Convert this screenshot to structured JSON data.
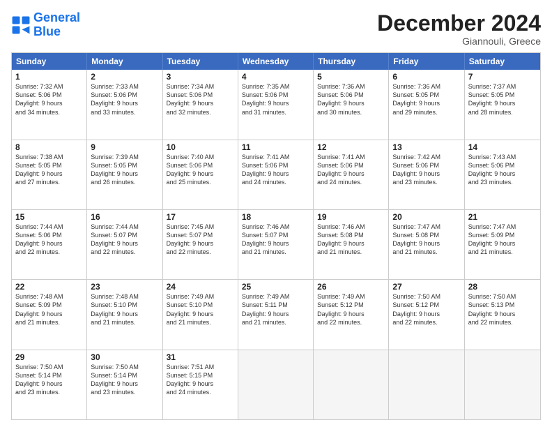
{
  "logo": {
    "general": "General",
    "blue": "Blue"
  },
  "header": {
    "month": "December 2024",
    "location": "Giannouli, Greece"
  },
  "weekdays": [
    "Sunday",
    "Monday",
    "Tuesday",
    "Wednesday",
    "Thursday",
    "Friday",
    "Saturday"
  ],
  "rows": [
    [
      {
        "day": "1",
        "lines": [
          "Sunrise: 7:32 AM",
          "Sunset: 5:06 PM",
          "Daylight: 9 hours",
          "and 34 minutes."
        ]
      },
      {
        "day": "2",
        "lines": [
          "Sunrise: 7:33 AM",
          "Sunset: 5:06 PM",
          "Daylight: 9 hours",
          "and 33 minutes."
        ]
      },
      {
        "day": "3",
        "lines": [
          "Sunrise: 7:34 AM",
          "Sunset: 5:06 PM",
          "Daylight: 9 hours",
          "and 32 minutes."
        ]
      },
      {
        "day": "4",
        "lines": [
          "Sunrise: 7:35 AM",
          "Sunset: 5:06 PM",
          "Daylight: 9 hours",
          "and 31 minutes."
        ]
      },
      {
        "day": "5",
        "lines": [
          "Sunrise: 7:36 AM",
          "Sunset: 5:06 PM",
          "Daylight: 9 hours",
          "and 30 minutes."
        ]
      },
      {
        "day": "6",
        "lines": [
          "Sunrise: 7:36 AM",
          "Sunset: 5:05 PM",
          "Daylight: 9 hours",
          "and 29 minutes."
        ]
      },
      {
        "day": "7",
        "lines": [
          "Sunrise: 7:37 AM",
          "Sunset: 5:05 PM",
          "Daylight: 9 hours",
          "and 28 minutes."
        ]
      }
    ],
    [
      {
        "day": "8",
        "lines": [
          "Sunrise: 7:38 AM",
          "Sunset: 5:05 PM",
          "Daylight: 9 hours",
          "and 27 minutes."
        ]
      },
      {
        "day": "9",
        "lines": [
          "Sunrise: 7:39 AM",
          "Sunset: 5:05 PM",
          "Daylight: 9 hours",
          "and 26 minutes."
        ]
      },
      {
        "day": "10",
        "lines": [
          "Sunrise: 7:40 AM",
          "Sunset: 5:06 PM",
          "Daylight: 9 hours",
          "and 25 minutes."
        ]
      },
      {
        "day": "11",
        "lines": [
          "Sunrise: 7:41 AM",
          "Sunset: 5:06 PM",
          "Daylight: 9 hours",
          "and 24 minutes."
        ]
      },
      {
        "day": "12",
        "lines": [
          "Sunrise: 7:41 AM",
          "Sunset: 5:06 PM",
          "Daylight: 9 hours",
          "and 24 minutes."
        ]
      },
      {
        "day": "13",
        "lines": [
          "Sunrise: 7:42 AM",
          "Sunset: 5:06 PM",
          "Daylight: 9 hours",
          "and 23 minutes."
        ]
      },
      {
        "day": "14",
        "lines": [
          "Sunrise: 7:43 AM",
          "Sunset: 5:06 PM",
          "Daylight: 9 hours",
          "and 23 minutes."
        ]
      }
    ],
    [
      {
        "day": "15",
        "lines": [
          "Sunrise: 7:44 AM",
          "Sunset: 5:06 PM",
          "Daylight: 9 hours",
          "and 22 minutes."
        ]
      },
      {
        "day": "16",
        "lines": [
          "Sunrise: 7:44 AM",
          "Sunset: 5:07 PM",
          "Daylight: 9 hours",
          "and 22 minutes."
        ]
      },
      {
        "day": "17",
        "lines": [
          "Sunrise: 7:45 AM",
          "Sunset: 5:07 PM",
          "Daylight: 9 hours",
          "and 22 minutes."
        ]
      },
      {
        "day": "18",
        "lines": [
          "Sunrise: 7:46 AM",
          "Sunset: 5:07 PM",
          "Daylight: 9 hours",
          "and 21 minutes."
        ]
      },
      {
        "day": "19",
        "lines": [
          "Sunrise: 7:46 AM",
          "Sunset: 5:08 PM",
          "Daylight: 9 hours",
          "and 21 minutes."
        ]
      },
      {
        "day": "20",
        "lines": [
          "Sunrise: 7:47 AM",
          "Sunset: 5:08 PM",
          "Daylight: 9 hours",
          "and 21 minutes."
        ]
      },
      {
        "day": "21",
        "lines": [
          "Sunrise: 7:47 AM",
          "Sunset: 5:09 PM",
          "Daylight: 9 hours",
          "and 21 minutes."
        ]
      }
    ],
    [
      {
        "day": "22",
        "lines": [
          "Sunrise: 7:48 AM",
          "Sunset: 5:09 PM",
          "Daylight: 9 hours",
          "and 21 minutes."
        ]
      },
      {
        "day": "23",
        "lines": [
          "Sunrise: 7:48 AM",
          "Sunset: 5:10 PM",
          "Daylight: 9 hours",
          "and 21 minutes."
        ]
      },
      {
        "day": "24",
        "lines": [
          "Sunrise: 7:49 AM",
          "Sunset: 5:10 PM",
          "Daylight: 9 hours",
          "and 21 minutes."
        ]
      },
      {
        "day": "25",
        "lines": [
          "Sunrise: 7:49 AM",
          "Sunset: 5:11 PM",
          "Daylight: 9 hours",
          "and 21 minutes."
        ]
      },
      {
        "day": "26",
        "lines": [
          "Sunrise: 7:49 AM",
          "Sunset: 5:12 PM",
          "Daylight: 9 hours",
          "and 22 minutes."
        ]
      },
      {
        "day": "27",
        "lines": [
          "Sunrise: 7:50 AM",
          "Sunset: 5:12 PM",
          "Daylight: 9 hours",
          "and 22 minutes."
        ]
      },
      {
        "day": "28",
        "lines": [
          "Sunrise: 7:50 AM",
          "Sunset: 5:13 PM",
          "Daylight: 9 hours",
          "and 22 minutes."
        ]
      }
    ],
    [
      {
        "day": "29",
        "lines": [
          "Sunrise: 7:50 AM",
          "Sunset: 5:14 PM",
          "Daylight: 9 hours",
          "and 23 minutes."
        ]
      },
      {
        "day": "30",
        "lines": [
          "Sunrise: 7:50 AM",
          "Sunset: 5:14 PM",
          "Daylight: 9 hours",
          "and 23 minutes."
        ]
      },
      {
        "day": "31",
        "lines": [
          "Sunrise: 7:51 AM",
          "Sunset: 5:15 PM",
          "Daylight: 9 hours",
          "and 24 minutes."
        ]
      },
      {
        "day": "",
        "lines": []
      },
      {
        "day": "",
        "lines": []
      },
      {
        "day": "",
        "lines": []
      },
      {
        "day": "",
        "lines": []
      }
    ]
  ]
}
